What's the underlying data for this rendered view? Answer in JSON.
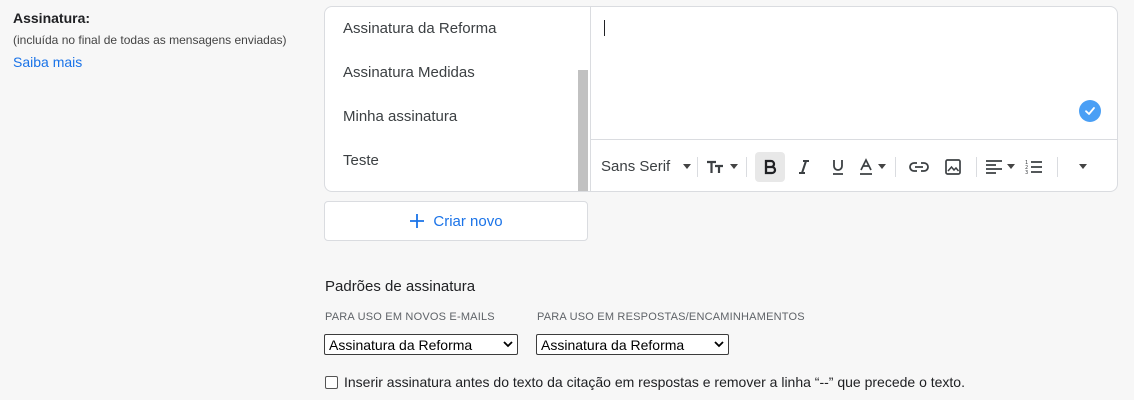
{
  "section": {
    "title": "Assinatura:",
    "subtitle": "(incluída no final de todas as mensagens enviadas)",
    "learn_more": "Saiba mais"
  },
  "signatures": [
    {
      "label": "Assinatura da Reforma"
    },
    {
      "label": "Assinatura Medidas"
    },
    {
      "label": "Minha assinatura"
    },
    {
      "label": "Teste"
    }
  ],
  "toolbar": {
    "font": "Sans Serif",
    "icons": [
      "text-size-icon",
      "bold-icon",
      "italic-icon",
      "underline-icon",
      "text-color-icon",
      "link-icon",
      "image-icon",
      "align-icon",
      "numbered-list-icon",
      "more-options-icon"
    ]
  },
  "create_button": {
    "label": "Criar novo",
    "icon": "plus-icon"
  },
  "defaults": {
    "title": "Padrões de assinatura",
    "new_emails_label": "PARA USO EM NOVOS E-MAILS",
    "new_emails_value": "Assinatura da Reforma",
    "replies_label": "PARA USO EM RESPOSTAS/ENCAMINHAMENTOS",
    "replies_value": "Assinatura da Reforma"
  },
  "checkbox": {
    "label": "Inserir assinatura antes do texto da citação em respostas e remover a linha “--” que precede o texto.",
    "checked": false
  },
  "colors": {
    "accent": "#1a73e8",
    "check_badge": "#4a9ff5"
  }
}
